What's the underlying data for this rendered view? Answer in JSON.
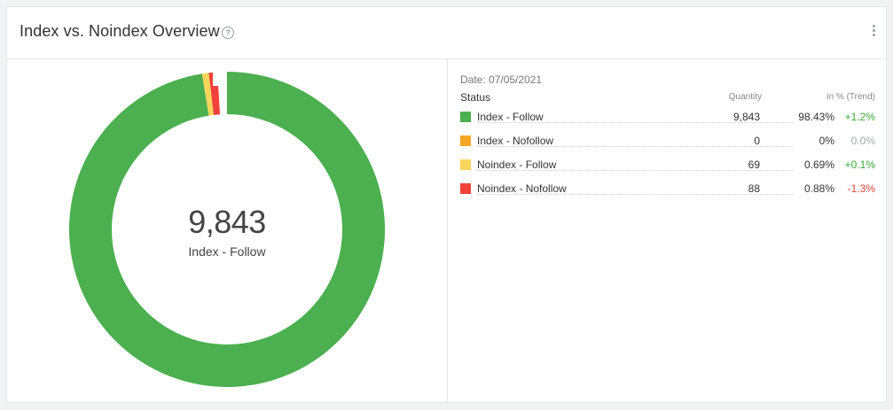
{
  "widget": {
    "title": "Index vs. Noindex Overview",
    "help_icon": "question-circle-icon",
    "menu_icon": "vertical-dots-icon"
  },
  "center": {
    "value": "9,843",
    "label": "Index - Follow"
  },
  "table": {
    "date": "Date: 07/05/2021",
    "headers": {
      "status": "Status",
      "quantity": "Quantity",
      "percent": "in % (Trend)"
    },
    "rows": [
      {
        "label": "Index - Follow",
        "quantity": "9,843",
        "percent": "98.43%",
        "trend": "+1.2%",
        "trend_dir": "pos",
        "color": "#4caf50"
      },
      {
        "label": "Index - Nofollow",
        "quantity": "0",
        "percent": "0%",
        "trend": "0.0%",
        "trend_dir": "zero",
        "color": "#f5a623"
      },
      {
        "label": "Noindex - Follow",
        "quantity": "69",
        "percent": "0.69%",
        "trend": "+0.1%",
        "trend_dir": "pos",
        "color": "#f9d55b"
      },
      {
        "label": "Noindex - Nofollow",
        "quantity": "88",
        "percent": "0.88%",
        "trend": "-1.3%",
        "trend_dir": "neg",
        "color": "#f0413a"
      }
    ]
  },
  "chart_data": {
    "type": "pie",
    "variant": "donut",
    "categories": [
      "Index - Follow",
      "Index - Nofollow",
      "Noindex - Follow",
      "Noindex - Nofollow"
    ],
    "values": [
      9843,
      0,
      69,
      88
    ],
    "colors": [
      "#4caf50",
      "#f5a623",
      "#f9d55b",
      "#f0413a"
    ],
    "highlighted": "Index - Follow"
  }
}
